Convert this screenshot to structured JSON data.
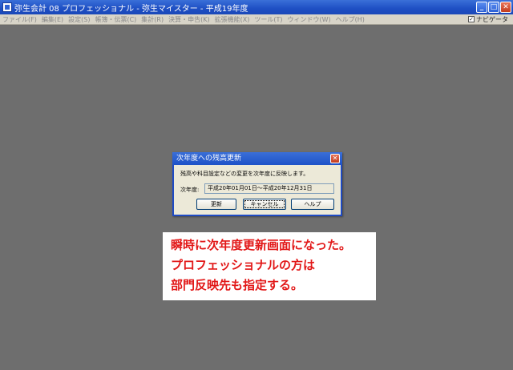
{
  "window": {
    "title": "弥生会計 08 プロフェッショナル - 弥生マイスター - 平成19年度"
  },
  "menu": {
    "items": [
      "ファイル(F)",
      "編集(E)",
      "設定(S)",
      "帳簿・伝票(C)",
      "集計(R)",
      "決算・申告(K)",
      "拡張機能(X)",
      "ツール(T)",
      "ウィンドウ(W)",
      "ヘルプ(H)"
    ],
    "navigator_label": "ナビゲータ",
    "navigator_checked": true
  },
  "dialog": {
    "title": "次年度への残高更新",
    "message": "残高や科目設定などの変更を次年度に反映します。",
    "next_year_label": "次年度:",
    "next_year_value": "平成20年01月01日～平成20年12月31日",
    "buttons": {
      "update": "更新",
      "cancel": "キャンセル",
      "help": "ヘルプ"
    }
  },
  "annotation": {
    "lines": [
      "瞬時に次年度更新画面になった。",
      "プロフェッショナルの方は",
      "部門反映先も指定する。"
    ]
  },
  "colors": {
    "workspace": "#6e6e6e",
    "titlebar": "#1e4fc4",
    "annotation_text": "#e21818"
  }
}
